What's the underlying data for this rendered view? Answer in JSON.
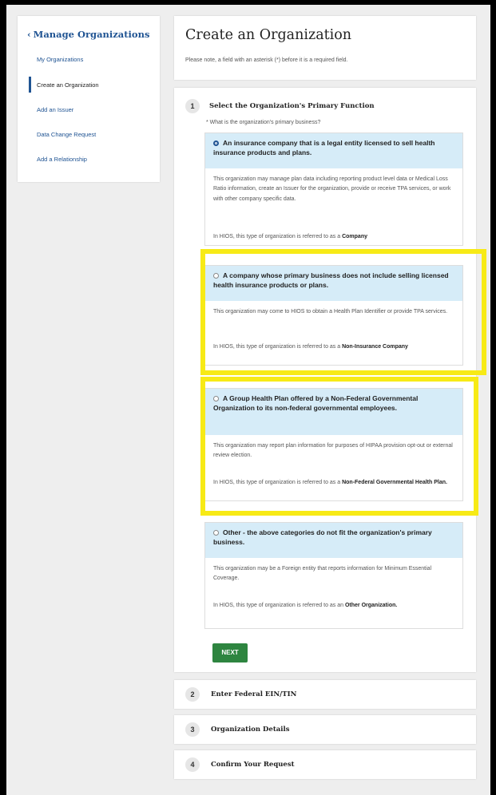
{
  "sidebar": {
    "title": "Manage Organizations",
    "items": [
      {
        "label": "My Organizations"
      },
      {
        "label": "Create an Organization"
      },
      {
        "label": "Add an Issuer"
      },
      {
        "label": "Data Change Request"
      },
      {
        "label": "Add a Relationship"
      }
    ]
  },
  "header": {
    "title": "Create an Organization",
    "note": "Please note, a field with an asterisk (*) before it is a required field."
  },
  "step1": {
    "number": "1",
    "title": "Select the Organization's Primary Function",
    "question": "* What is the organization's primary business?",
    "options": [
      {
        "label": "An insurance company that is a legal entity licensed to sell health insurance products and plans.",
        "desc": "This organization may manage plan data including reporting product level data or Medical Loss Ratio information, create an Issuer for the organization, provide or receive TPA services, or work with other company specific data.",
        "note_prefix": "In HIOS, this type of organization is referred to as a ",
        "note_term": "Company",
        "selected": true
      },
      {
        "label": "A company whose primary business does not include selling licensed health insurance products or plans.",
        "desc": "This organization may come to HIOS to obtain a Health Plan Identifier or provide TPA services.",
        "note_prefix": "In HIOS, this type of organization is referred to as a ",
        "note_term": "Non-Insurance Company",
        "selected": false
      },
      {
        "label": "A Group Health Plan offered by a Non-Federal Governmental Organization to its non-federal governmental employees.",
        "desc": "This organization may report plan information for purposes of HIPAA provision opt-out or external review election.",
        "note_prefix": "In HIOS, this type of organization is referred to as a ",
        "note_term": "Non-Federal Governmental Health Plan.",
        "selected": false
      },
      {
        "label": "Other - the above categories do not fit the organization's primary business.",
        "desc": "This organization may be a Foreign entity that reports information for Minimum Essential Coverage.",
        "note_prefix": "In HIOS, this type of organization is referred to as an ",
        "note_term": "Other Organization.",
        "selected": false
      }
    ],
    "next_label": "NEXT"
  },
  "steps": [
    {
      "number": "2",
      "title": "Enter Federal EIN/TIN"
    },
    {
      "number": "3",
      "title": "Organization Details"
    },
    {
      "number": "4",
      "title": "Confirm Your Request"
    }
  ],
  "colors": {
    "link": "#205493",
    "option_header": "#d6ecf8",
    "next_button": "#2e8540",
    "highlight": "#f7ea16"
  }
}
